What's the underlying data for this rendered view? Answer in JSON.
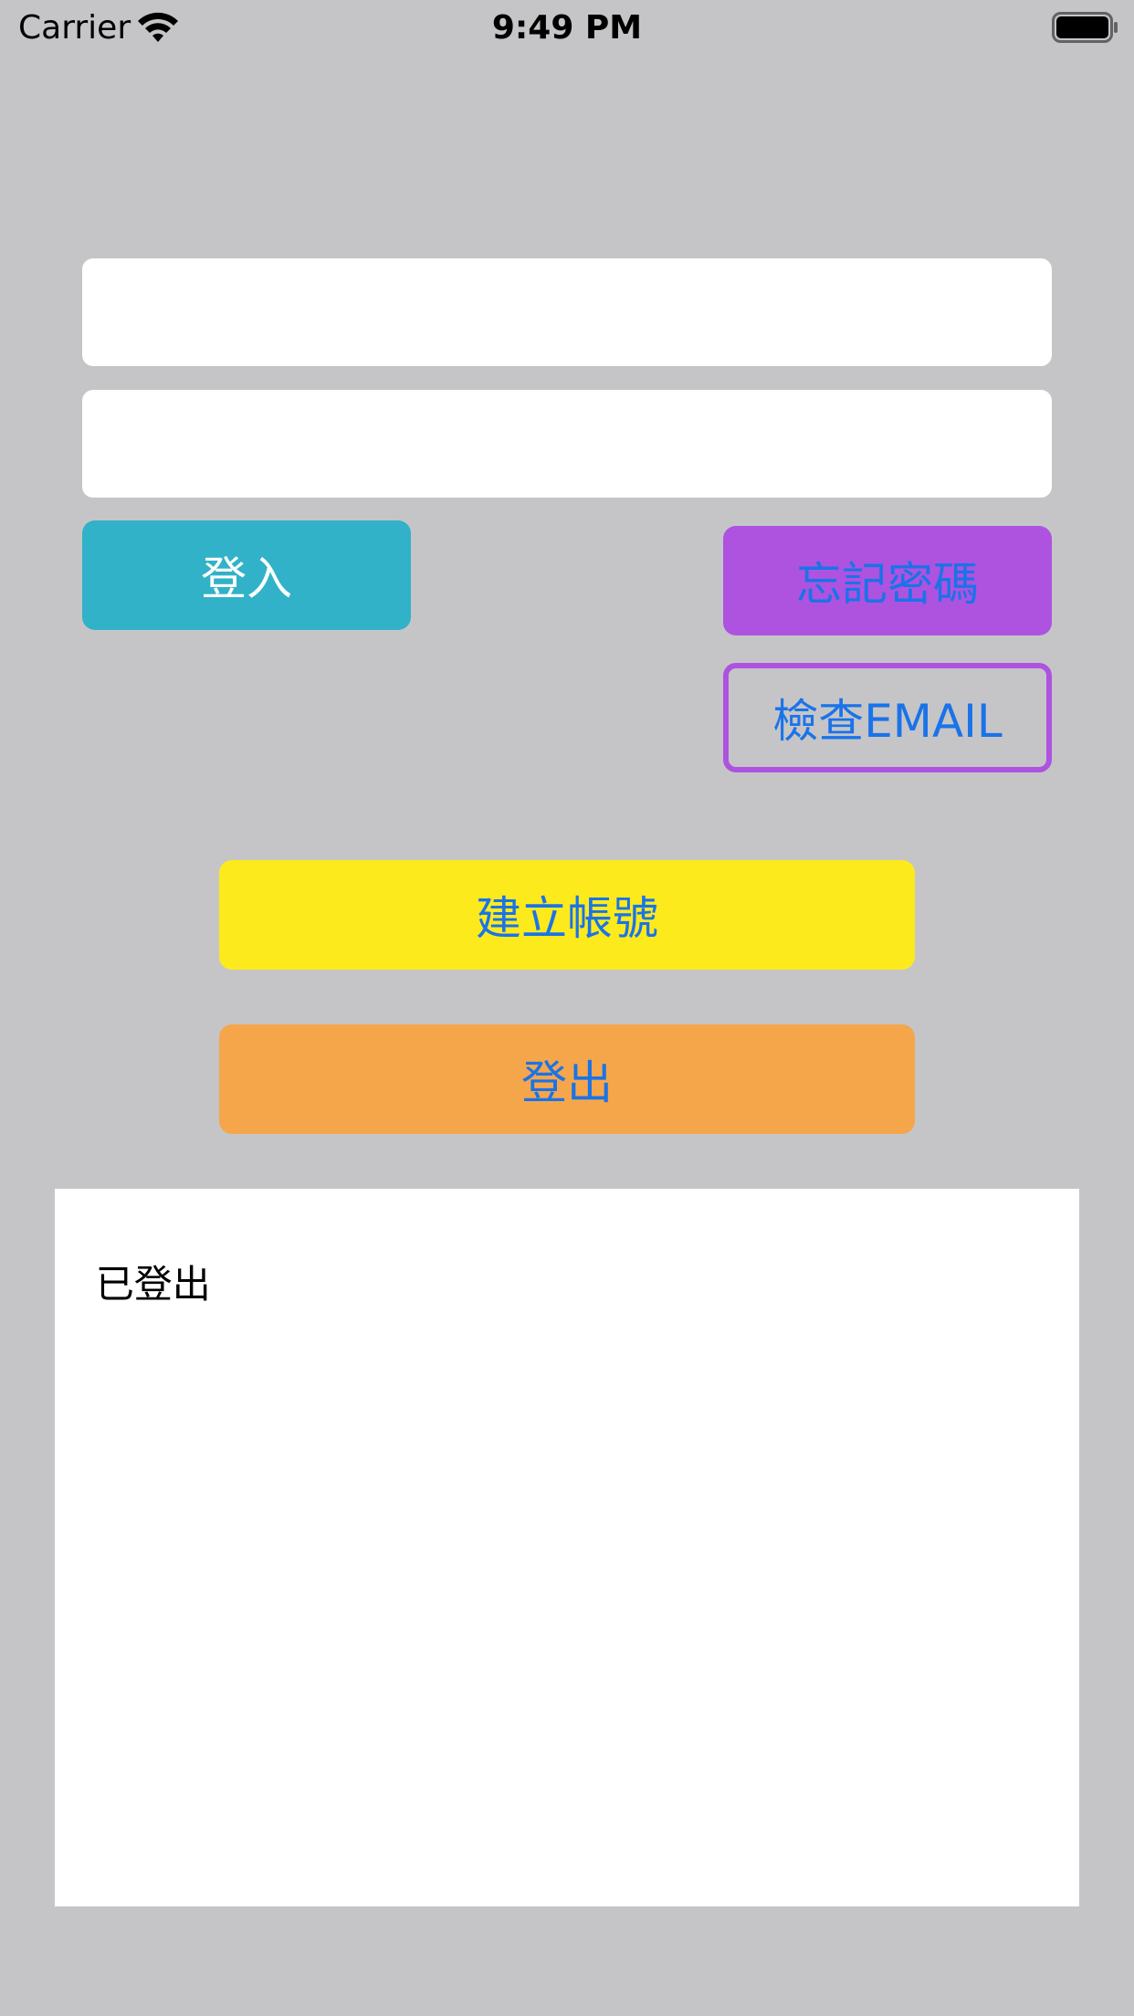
{
  "status_bar": {
    "carrier": "Carrier",
    "time": "9:49 PM",
    "wifi_icon": "wifi-icon",
    "battery_icon": "battery-icon"
  },
  "form": {
    "email_field": {
      "value": "",
      "placeholder": ""
    },
    "password_field": {
      "value": "",
      "placeholder": ""
    }
  },
  "buttons": {
    "login": "登入",
    "forgot_password": "忘記密碼",
    "check_email": "檢查EMAIL",
    "create_account": "建立帳號",
    "logout": "登出"
  },
  "log": {
    "text": "已登出"
  },
  "colors": {
    "background": "#c5c5c8",
    "login": "#31b2c8",
    "forgot": "#ad53e0",
    "create": "#fdea1d",
    "logout": "#f5a64b",
    "button_text": "#1a73e8"
  }
}
